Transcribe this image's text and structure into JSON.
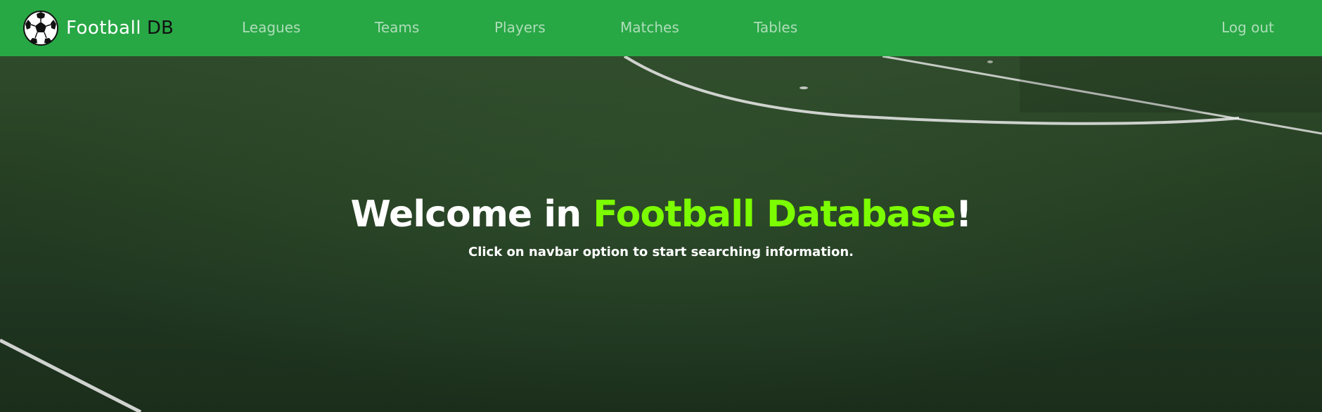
{
  "brand": {
    "name": "Football",
    "suffix": "DB",
    "logo_icon": "soccer-ball-icon"
  },
  "nav": {
    "leagues": "Leagues",
    "teams": "Teams",
    "players": "Players",
    "matches": "Matches",
    "tables": "Tables",
    "logout": "Log out"
  },
  "hero": {
    "title_prefix": "Welcome in ",
    "title_highlight": "Football Database",
    "title_suffix": "!",
    "subtitle": "Click on navbar option to start searching information."
  },
  "colors": {
    "navbar": "#28a745",
    "accent": "#7cfc00",
    "field": "#23361f"
  }
}
